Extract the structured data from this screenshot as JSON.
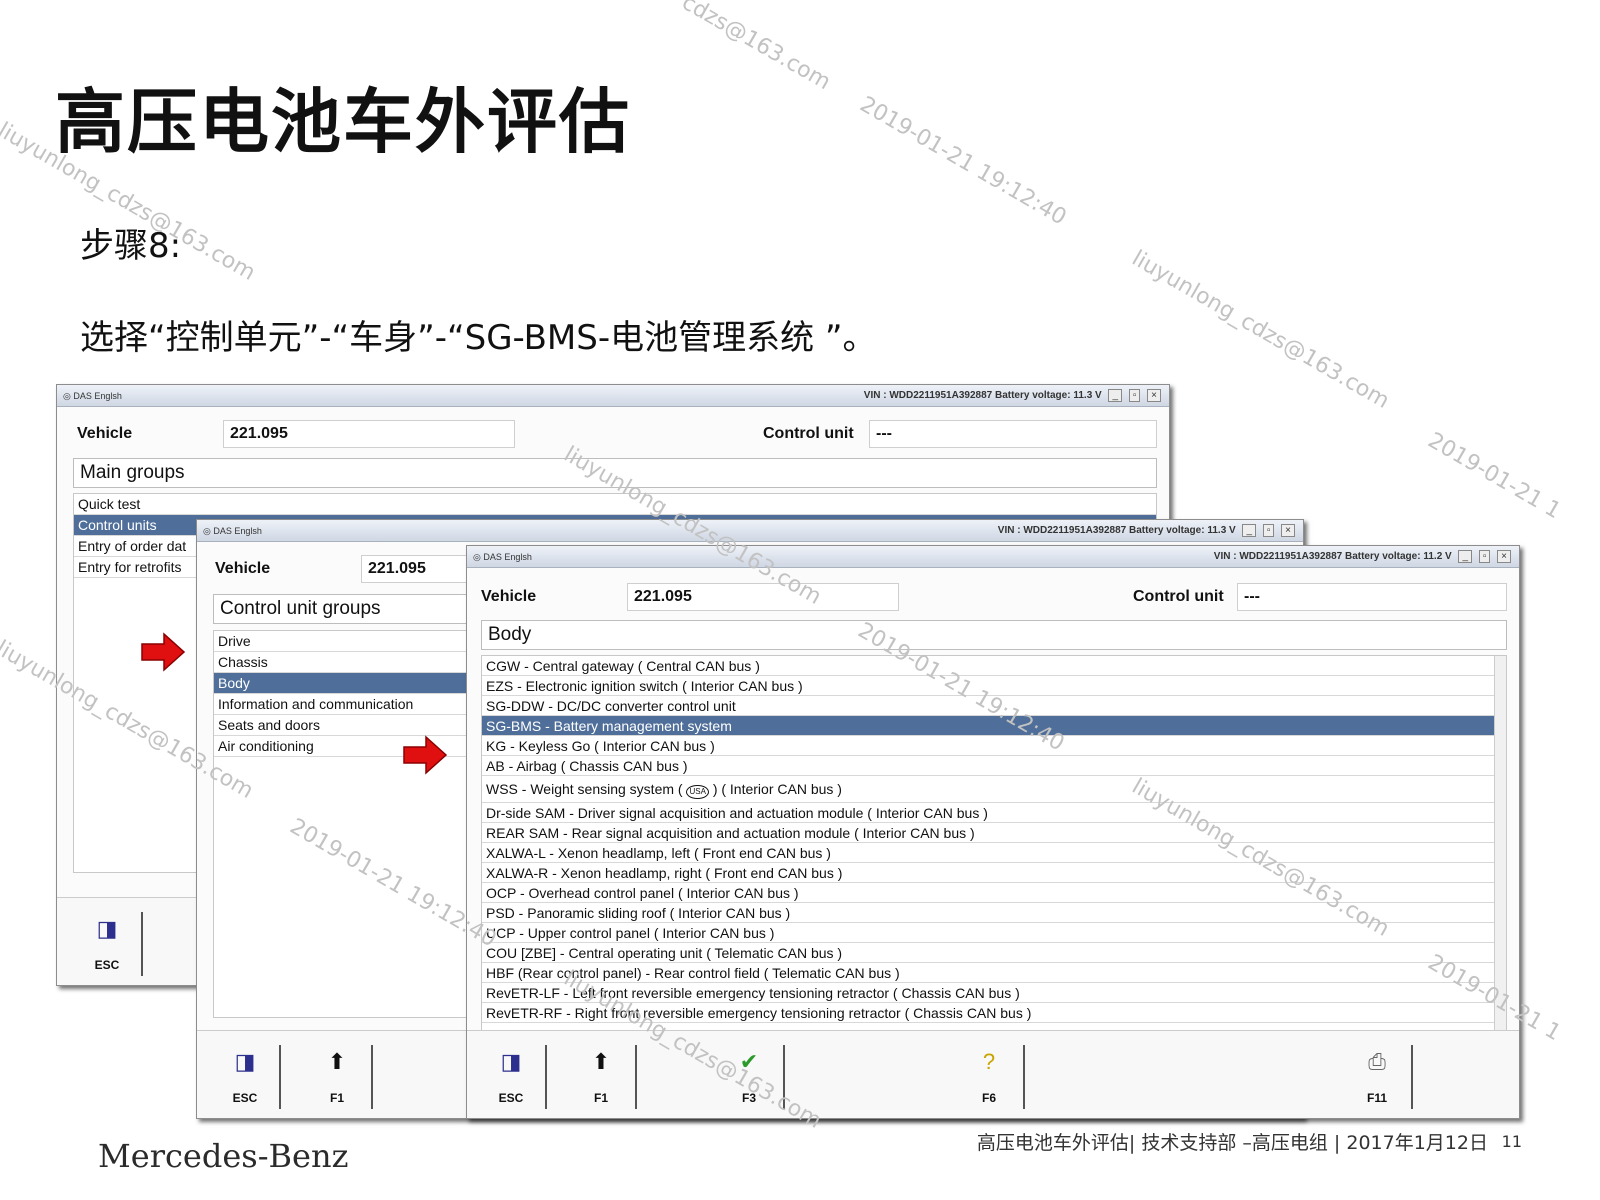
{
  "slide": {
    "title": "高压电池车外评估",
    "step": "步骤8:",
    "instruction": "选择“控制单元”-“车身”-“SG-BMS-电池管理系统 ”。"
  },
  "app": {
    "name": "DAS Englsh",
    "minimize": "_",
    "maximize": "▫",
    "close": "×"
  },
  "win1": {
    "status": "VIN : WDD2211951A392887   Battery voltage: 11.3 V",
    "vehicle_label": "Vehicle",
    "vehicle_value": "221.095",
    "control_unit_label": "Control unit",
    "control_unit_value": "---",
    "group_title": "Main groups",
    "items": [
      "Quick test",
      "Control units",
      "Entry of order dat",
      "Entry for retrofits"
    ],
    "esc_label": "ESC"
  },
  "win2": {
    "status": "VIN : WDD2211951A392887   Battery voltage: 11.3 V",
    "vehicle_label": "Vehicle",
    "vehicle_value": "221.095",
    "group_title": "Control unit groups",
    "items": [
      "Drive",
      "Chassis",
      "Body",
      "Information and communication",
      "Seats and doors",
      "Air conditioning"
    ],
    "esc_label": "ESC",
    "f1_label": "F1"
  },
  "win3": {
    "status": "VIN : WDD2211951A392887   Battery voltage: 11.2 V",
    "vehicle_label": "Vehicle",
    "vehicle_value": "221.095",
    "control_unit_label": "Control unit",
    "control_unit_value": "---",
    "group_title": "Body",
    "items": [
      "CGW - Central gateway ( Central CAN bus )",
      "EZS - Electronic ignition switch ( Interior CAN bus )",
      "SG-DDW - DC/DC converter control unit",
      "SG-BMS - Battery management system",
      "KG - Keyless Go ( Interior CAN bus )",
      "AB - Airbag ( Chassis CAN bus )",
      "WSS - Weight sensing system (",
      "Dr-side SAM - Driver signal acquisition and actuation module ( Interior CAN bus )",
      "REAR SAM - Rear signal acquisition and actuation module ( Interior CAN bus )",
      "XALWA-L - Xenon headlamp, left ( Front end CAN bus )",
      "XALWA-R - Xenon headlamp, right ( Front end CAN bus )",
      "OCP - Overhead control panel ( Interior CAN bus )",
      "PSD - Panoramic sliding roof ( Interior CAN bus )",
      "UCP - Upper control panel ( Interior CAN bus )",
      "COU [ZBE] - Central operating unit ( Telematic CAN bus )",
      "HBF (Rear control panel) - Rear control field ( Telematic CAN bus )",
      "RevETR-LF - Left front reversible emergency tensioning retractor ( Chassis CAN bus )",
      "RevETR-RF - Right front reversible emergency tensioning retractor ( Chassis CAN bus )"
    ],
    "wss_badge": "USA",
    "wss_suffix": ") ( Interior CAN bus )",
    "esc_label": "ESC",
    "f1_label": "F1",
    "f3_label": "F3",
    "f6_label": "F6",
    "f11_label": "F11"
  },
  "footer": {
    "brand": "Mercedes-Benz",
    "info": "高压电池车外评估| 技术支持部 –高压电组 | 2017年1月12日",
    "page": "11"
  },
  "watermarks": {
    "email": "liuyunlong_cdzs@163.com",
    "email_fragment": "cdzs@163.com",
    "timestamp": "2019-01-21 19:12:40",
    "date_fragment": "2019-01-21 1"
  },
  "colors": {
    "selection": "#4f6f9a",
    "arrow": "#e01010",
    "watermark": "#c2c2c2"
  }
}
